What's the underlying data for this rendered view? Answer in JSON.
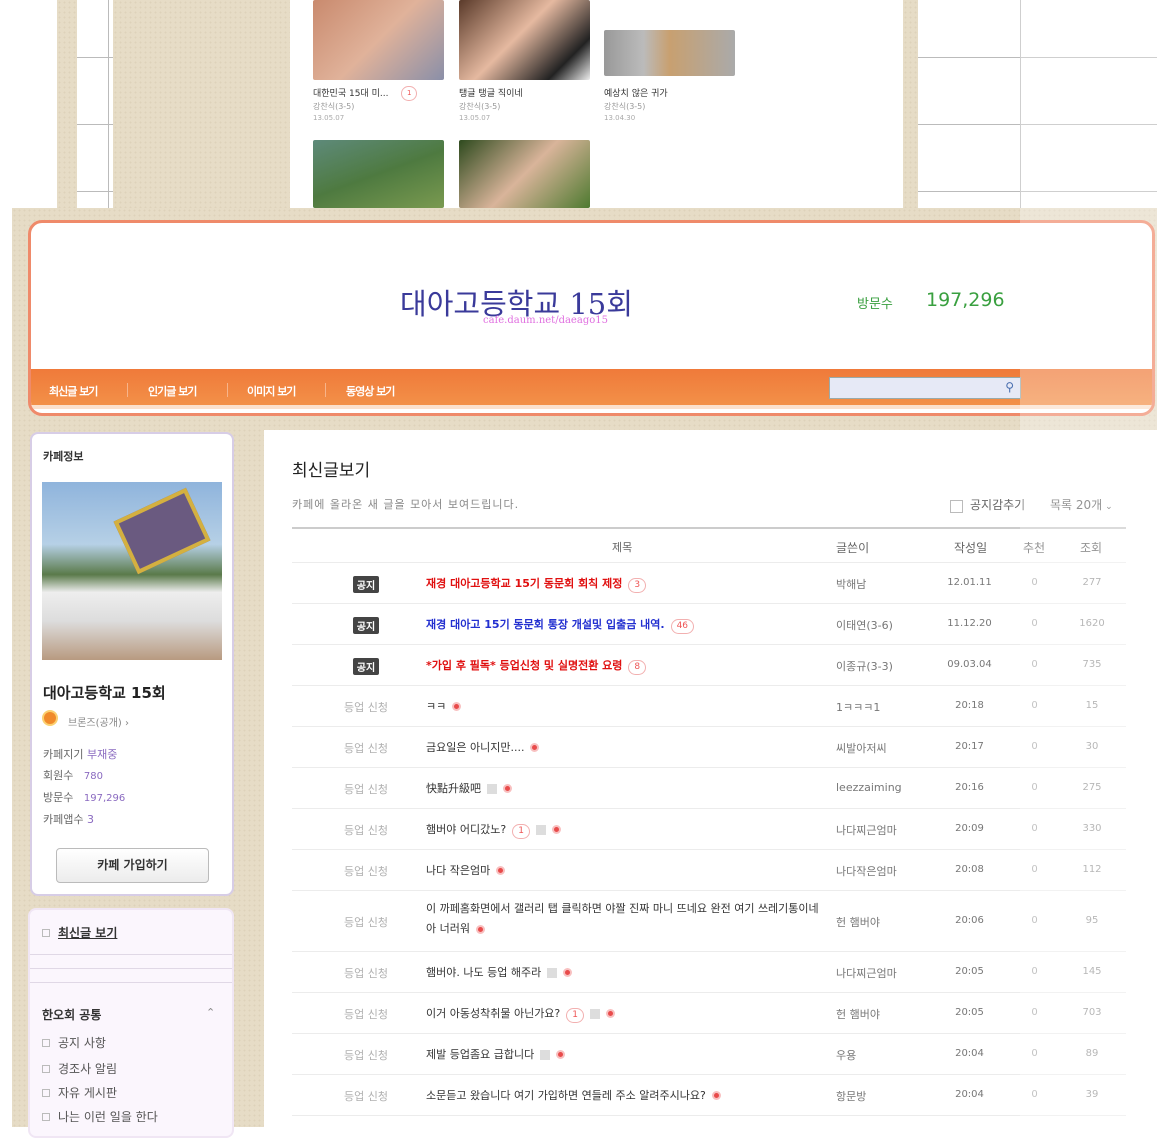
{
  "gallery": [
    {
      "title": "대한민국 15대 미...",
      "comments": "1",
      "author": "강찬식(3-5)",
      "date": "13.05.07"
    },
    {
      "title": "탱글 탱글 직이네",
      "author": "강찬식(3-5)",
      "date": "13.05.07"
    },
    {
      "title": "예상치 않은 귀가",
      "author": "강찬식(3-5)",
      "date": "13.04.30"
    }
  ],
  "header": {
    "cafe_name": "대아고등학교 15회",
    "url": "cafe.daum.net/daeago15",
    "visits_label": "방문수",
    "visits": "197,296"
  },
  "nav": {
    "items": [
      "최신글 보기",
      "인기글 보기",
      "이미지 보기",
      "동영상 보기"
    ],
    "search_placeholder": ""
  },
  "sidebar": {
    "info_title": "카페정보",
    "cafe_name": "대아고등학교 15회",
    "grade": "브론즈(공개)",
    "manager_label": "카페지기",
    "manager": "부재중",
    "members_label": "회원수",
    "members": "780",
    "visits_label": "방문수",
    "visits": "197,296",
    "apps_label": "카페앱수",
    "apps": "3",
    "join_button": "카페 가입하기",
    "recent_link": "최신글 보기",
    "group_title": "한오회 공통",
    "menu": [
      "공지 사항",
      "경조사 알림",
      "자유 게시판",
      "나는 이런 일을 한다"
    ]
  },
  "main": {
    "title": "최신글보기",
    "subtitle": "카페에 올라온 새 글을 모아서 보여드립니다.",
    "hide_notice": "공지감추기",
    "list_count": "목록 20개",
    "columns": [
      "제목",
      "글쓴이",
      "작성일",
      "추천",
      "조회"
    ],
    "rows": [
      {
        "status": "공지",
        "title": "재경 대아고등학교 15기 동문회 회칙 제정",
        "comments": "3",
        "author": "박해남",
        "date": "12.01.11",
        "rec": "0",
        "views": "277",
        "style": "red",
        "notice": true
      },
      {
        "status": "공지",
        "title": "재경 대아고 15기 동문회 통장 개설및 입출금 내역.",
        "comments": "46",
        "author": "이태연(3-6)",
        "date": "11.12.20",
        "rec": "0",
        "views": "1620",
        "style": "blue",
        "notice": true
      },
      {
        "status": "공지",
        "title": "*가입 후 필독* 등업신청 및 실명전환 요령",
        "comments": "8",
        "author": "이종규(3-3)",
        "date": "09.03.04",
        "rec": "0",
        "views": "735",
        "style": "red",
        "notice": true
      },
      {
        "status": "등업 신청",
        "title": "ㅋㅋ",
        "author": "1ㅋㅋㅋ1",
        "date": "20:18",
        "rec": "0",
        "views": "15",
        "new": true
      },
      {
        "status": "등업 신청",
        "title": "금요일은 아니지만....",
        "author": "씨발아저씨",
        "date": "20:17",
        "rec": "0",
        "views": "30",
        "new": true
      },
      {
        "status": "등업 신청",
        "title": "快點升級吧",
        "author": "leezzaiming",
        "date": "20:16",
        "rec": "0",
        "views": "275",
        "img": true,
        "new": true
      },
      {
        "status": "등업 신청",
        "title": "햄버야 어디갔노?",
        "comments": "1",
        "author": "나다찌근엄마",
        "date": "20:09",
        "rec": "0",
        "views": "330",
        "img": true,
        "new": true
      },
      {
        "status": "등업 신청",
        "title": "나다 작은엄마",
        "author": "나다작은엄마",
        "date": "20:08",
        "rec": "0",
        "views": "112",
        "new": true
      },
      {
        "status": "등업 신청",
        "title": "이 까페홈화면에서 갤러리 탭 클릭하면 야짤 진짜 마니 뜨네요 완전 여기 쓰레기통이네 아 너러워",
        "author": "헌 햄버야",
        "date": "20:06",
        "rec": "0",
        "views": "95",
        "new": true,
        "tall": true
      },
      {
        "status": "등업 신청",
        "title": "햄버야. 나도 등업 해주라",
        "author": "나다찌근엄마",
        "date": "20:05",
        "rec": "0",
        "views": "145",
        "img": true,
        "new": true
      },
      {
        "status": "등업 신청",
        "title": "이거 아동성착취물 아닌가요?",
        "comments": "1",
        "author": "헌 햄버야",
        "date": "20:05",
        "rec": "0",
        "views": "703",
        "img": true,
        "new": true
      },
      {
        "status": "등업 신청",
        "title": "제발 등업좀요 급합니다",
        "author": "우용",
        "date": "20:04",
        "rec": "0",
        "views": "89",
        "img": true,
        "new": true
      },
      {
        "status": "등업 신청",
        "title": "소문듣고 왔습니다 여기 가입하면 연들레 주소 알려주시나요?",
        "author": "항문방",
        "date": "20:04",
        "rec": "0",
        "views": "39",
        "new": true
      }
    ]
  }
}
